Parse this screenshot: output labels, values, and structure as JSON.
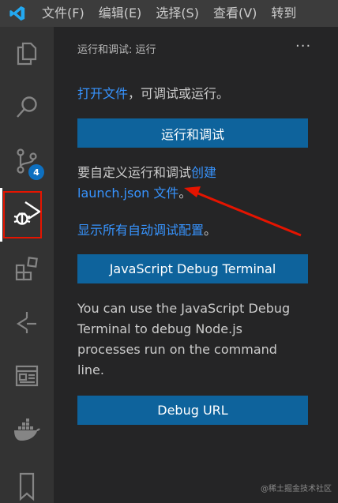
{
  "menubar": {
    "items": [
      "文件(F)",
      "编辑(E)",
      "选择(S)",
      "查看(V)",
      "转到"
    ]
  },
  "activitybar": {
    "scm_badge": "4"
  },
  "panel": {
    "header": "运行和调试: 运行",
    "more_label": "···",
    "open_file_link": "打开文件",
    "open_file_suffix": "，可调试或运行。",
    "run_debug_button": "运行和调试",
    "customize_prefix": "要自定义运行和调试",
    "customize_link_line1": "创建",
    "customize_link_line2": "launch.json 文件",
    "customize_suffix": "。",
    "show_configs_link": "显示所有自动调试配置",
    "show_configs_suffix": "。",
    "js_terminal_button": "JavaScript Debug Terminal",
    "js_terminal_desc_line1": "You can use the JavaScript Debug",
    "js_terminal_desc_line2": "Terminal to debug Node.js",
    "js_terminal_desc_line3": "processes run on the command",
    "js_terminal_desc_line4": "line.",
    "debug_url_button": "Debug URL"
  },
  "watermark": "@稀土掘金技术社区",
  "colors": {
    "accent": "#0e639c",
    "link": "#3794ff",
    "highlight": "#e51400"
  }
}
